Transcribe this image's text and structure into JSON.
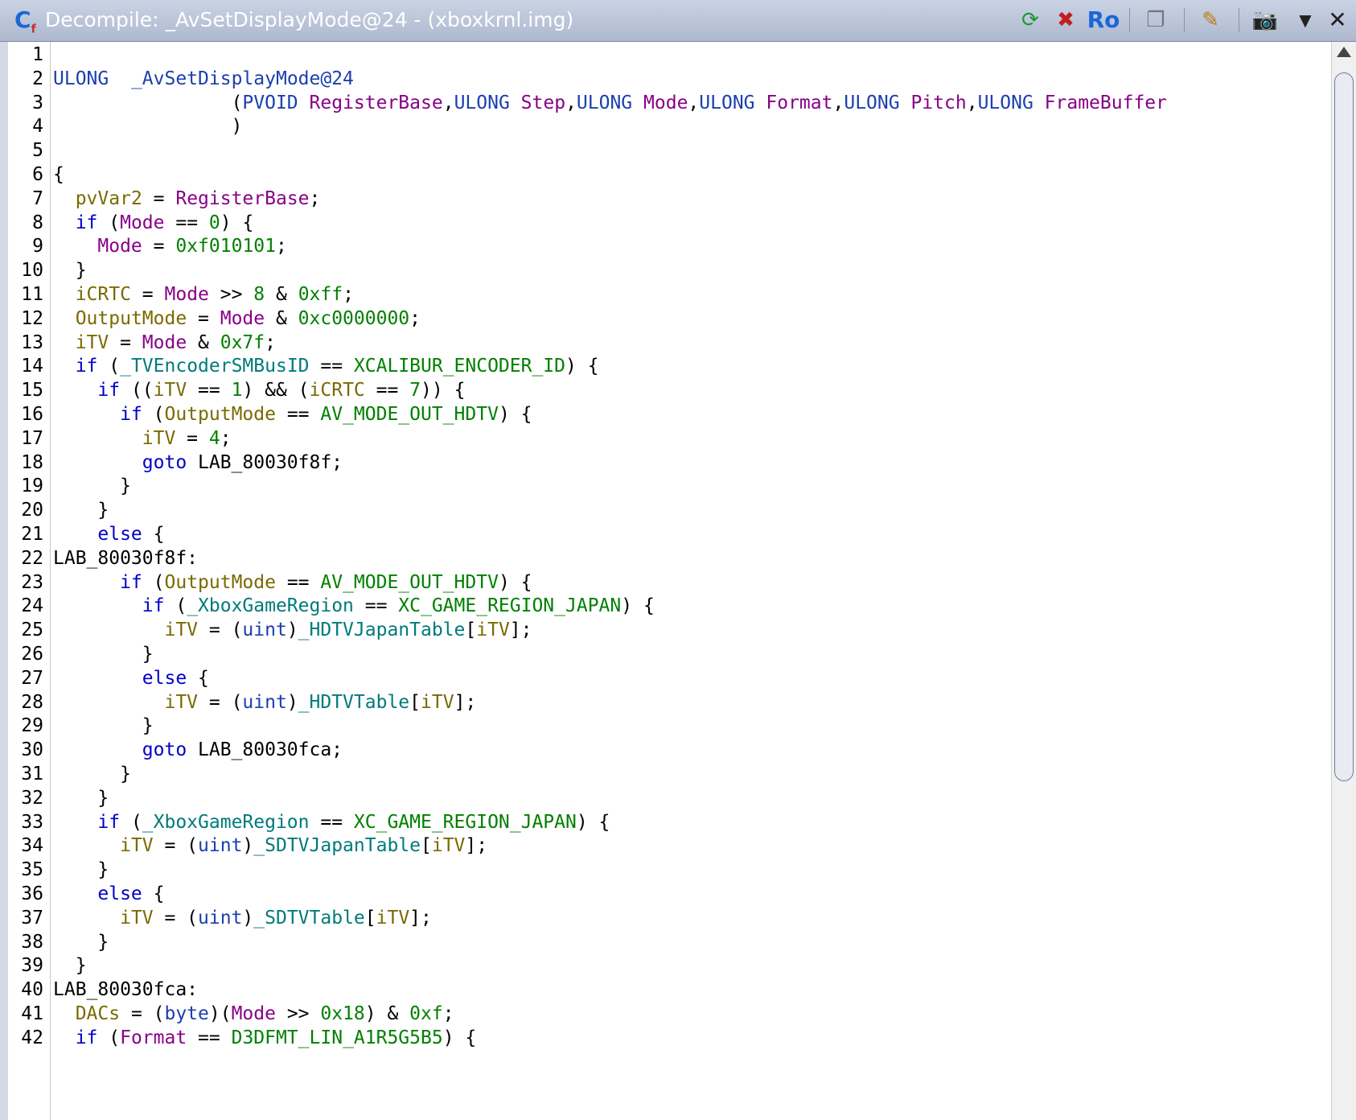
{
  "window": {
    "title": "Decompile: _AvSetDisplayMode@24 -  (xboxkrnl.img)",
    "icon_glyph": "C",
    "toolbar": [
      {
        "name": "refresh-icon",
        "glyph": "⟳"
      },
      {
        "name": "disable-snapshot-icon",
        "glyph": "✖"
      },
      {
        "name": "read-only-icon",
        "glyph": "Ro"
      },
      {
        "name": "copy-icon",
        "glyph": "❐"
      },
      {
        "name": "edit-icon",
        "glyph": "✎"
      },
      {
        "name": "snapshot-icon",
        "glyph": "📷"
      },
      {
        "name": "menu-dropdown-icon",
        "glyph": "▼"
      },
      {
        "name": "close-icon",
        "glyph": "✕"
      }
    ]
  },
  "code": {
    "lines": [
      {
        "n": "1",
        "t": []
      },
      {
        "n": "2",
        "t": [
          [
            "ty",
            "ULONG"
          ],
          [
            "",
            "  "
          ],
          [
            "fn",
            "_AvSetDisplayMode@24"
          ]
        ]
      },
      {
        "n": "3",
        "t": [
          [
            "",
            "                "
          ],
          [
            "",
            "("
          ],
          [
            "ty",
            "PVOID"
          ],
          [
            "",
            " "
          ],
          [
            "pr",
            "RegisterBase"
          ],
          [
            "",
            ","
          ],
          [
            "ty",
            "ULONG"
          ],
          [
            "",
            " "
          ],
          [
            "pr",
            "Step"
          ],
          [
            "",
            ","
          ],
          [
            "ty",
            "ULONG"
          ],
          [
            "",
            " "
          ],
          [
            "pr",
            "Mode"
          ],
          [
            "",
            ","
          ],
          [
            "ty",
            "ULONG"
          ],
          [
            "",
            " "
          ],
          [
            "pr",
            "Format"
          ],
          [
            "",
            ","
          ],
          [
            "ty",
            "ULONG"
          ],
          [
            "",
            " "
          ],
          [
            "pr",
            "Pitch"
          ],
          [
            "",
            ","
          ],
          [
            "ty",
            "ULONG"
          ],
          [
            "",
            " "
          ],
          [
            "pr",
            "FrameBuffer"
          ]
        ]
      },
      {
        "n": "4",
        "t": [
          [
            "",
            "                )"
          ]
        ]
      },
      {
        "n": "5",
        "t": []
      },
      {
        "n": "6",
        "t": [
          [
            "",
            "{"
          ]
        ]
      },
      {
        "n": "7",
        "t": [
          [
            "",
            "  "
          ],
          [
            "lv",
            "pvVar2"
          ],
          [
            "",
            " = "
          ],
          [
            "pr",
            "RegisterBase"
          ],
          [
            "",
            ";"
          ]
        ]
      },
      {
        "n": "8",
        "t": [
          [
            "",
            "  "
          ],
          [
            "kw",
            "if"
          ],
          [
            "",
            " ("
          ],
          [
            "pr",
            "Mode"
          ],
          [
            "",
            " == "
          ],
          [
            "nu",
            "0"
          ],
          [
            "",
            ") {"
          ]
        ]
      },
      {
        "n": "9",
        "t": [
          [
            "",
            "    "
          ],
          [
            "pr",
            "Mode"
          ],
          [
            "",
            " = "
          ],
          [
            "nu",
            "0xf010101"
          ],
          [
            "",
            ";"
          ]
        ]
      },
      {
        "n": "10",
        "t": [
          [
            "",
            "  }"
          ]
        ]
      },
      {
        "n": "11",
        "t": [
          [
            "",
            "  "
          ],
          [
            "lv",
            "iCRTC"
          ],
          [
            "",
            " = "
          ],
          [
            "pr",
            "Mode"
          ],
          [
            "",
            " >> "
          ],
          [
            "nu",
            "8"
          ],
          [
            "",
            " & "
          ],
          [
            "nu",
            "0xff"
          ],
          [
            "",
            ";"
          ]
        ]
      },
      {
        "n": "12",
        "t": [
          [
            "",
            "  "
          ],
          [
            "lv",
            "OutputMode"
          ],
          [
            "",
            " = "
          ],
          [
            "pr",
            "Mode"
          ],
          [
            "",
            " & "
          ],
          [
            "nu",
            "0xc0000000"
          ],
          [
            "",
            ";"
          ]
        ]
      },
      {
        "n": "13",
        "t": [
          [
            "",
            "  "
          ],
          [
            "lv",
            "iTV"
          ],
          [
            "",
            " = "
          ],
          [
            "pr",
            "Mode"
          ],
          [
            "",
            " & "
          ],
          [
            "nu",
            "0x7f"
          ],
          [
            "",
            ";"
          ]
        ]
      },
      {
        "n": "14",
        "t": [
          [
            "",
            "  "
          ],
          [
            "kw",
            "if"
          ],
          [
            "",
            " ("
          ],
          [
            "gl",
            "_TVEncoderSMBusID"
          ],
          [
            "",
            " == "
          ],
          [
            "cn",
            "XCALIBUR_ENCODER_ID"
          ],
          [
            "",
            ") {"
          ]
        ]
      },
      {
        "n": "15",
        "t": [
          [
            "",
            "    "
          ],
          [
            "kw",
            "if"
          ],
          [
            "",
            " (("
          ],
          [
            "lv",
            "iTV"
          ],
          [
            "",
            " == "
          ],
          [
            "nu",
            "1"
          ],
          [
            "",
            ") && ("
          ],
          [
            "lv",
            "iCRTC"
          ],
          [
            "",
            " == "
          ],
          [
            "nu",
            "7"
          ],
          [
            "",
            ")) {"
          ]
        ]
      },
      {
        "n": "16",
        "t": [
          [
            "",
            "      "
          ],
          [
            "kw",
            "if"
          ],
          [
            "",
            " ("
          ],
          [
            "lv",
            "OutputMode"
          ],
          [
            "",
            " == "
          ],
          [
            "cn",
            "AV_MODE_OUT_HDTV"
          ],
          [
            "",
            ") {"
          ]
        ]
      },
      {
        "n": "17",
        "t": [
          [
            "",
            "        "
          ],
          [
            "lv",
            "iTV"
          ],
          [
            "",
            " = "
          ],
          [
            "nu",
            "4"
          ],
          [
            "",
            ";"
          ]
        ]
      },
      {
        "n": "18",
        "t": [
          [
            "",
            "        "
          ],
          [
            "kw",
            "goto"
          ],
          [
            "",
            " LAB_80030f8f;"
          ]
        ]
      },
      {
        "n": "19",
        "t": [
          [
            "",
            "      }"
          ]
        ]
      },
      {
        "n": "20",
        "t": [
          [
            "",
            "    }"
          ]
        ]
      },
      {
        "n": "21",
        "t": [
          [
            "",
            "    "
          ],
          [
            "kw",
            "else"
          ],
          [
            "",
            " {"
          ]
        ]
      },
      {
        "n": "22",
        "t": [
          [
            "",
            "LAB_80030f8f:"
          ]
        ]
      },
      {
        "n": "23",
        "t": [
          [
            "",
            "      "
          ],
          [
            "kw",
            "if"
          ],
          [
            "",
            " ("
          ],
          [
            "lv",
            "OutputMode"
          ],
          [
            "",
            " == "
          ],
          [
            "cn",
            "AV_MODE_OUT_HDTV"
          ],
          [
            "",
            ") {"
          ]
        ]
      },
      {
        "n": "24",
        "t": [
          [
            "",
            "        "
          ],
          [
            "kw",
            "if"
          ],
          [
            "",
            " ("
          ],
          [
            "gl",
            "_XboxGameRegion"
          ],
          [
            "",
            " == "
          ],
          [
            "cn",
            "XC_GAME_REGION_JAPAN"
          ],
          [
            "",
            ") {"
          ]
        ]
      },
      {
        "n": "25",
        "t": [
          [
            "",
            "          "
          ],
          [
            "lv",
            "iTV"
          ],
          [
            "",
            " = ("
          ],
          [
            "ty",
            "uint"
          ],
          [
            "",
            ")"
          ],
          [
            "gl",
            "_HDTVJapanTable"
          ],
          [
            "",
            "["
          ],
          [
            "lv",
            "iTV"
          ],
          [
            "",
            "];"
          ]
        ]
      },
      {
        "n": "26",
        "t": [
          [
            "",
            "        }"
          ]
        ]
      },
      {
        "n": "27",
        "t": [
          [
            "",
            "        "
          ],
          [
            "kw",
            "else"
          ],
          [
            "",
            " {"
          ]
        ]
      },
      {
        "n": "28",
        "t": [
          [
            "",
            "          "
          ],
          [
            "lv",
            "iTV"
          ],
          [
            "",
            " = ("
          ],
          [
            "ty",
            "uint"
          ],
          [
            "",
            ")"
          ],
          [
            "gl",
            "_HDTVTable"
          ],
          [
            "",
            "["
          ],
          [
            "lv",
            "iTV"
          ],
          [
            "",
            "];"
          ]
        ]
      },
      {
        "n": "29",
        "t": [
          [
            "",
            "        }"
          ]
        ]
      },
      {
        "n": "30",
        "t": [
          [
            "",
            "        "
          ],
          [
            "kw",
            "goto"
          ],
          [
            "",
            " LAB_80030fca;"
          ]
        ]
      },
      {
        "n": "31",
        "t": [
          [
            "",
            "      }"
          ]
        ]
      },
      {
        "n": "32",
        "t": [
          [
            "",
            "    }"
          ]
        ]
      },
      {
        "n": "33",
        "t": [
          [
            "",
            "    "
          ],
          [
            "kw",
            "if"
          ],
          [
            "",
            " ("
          ],
          [
            "gl",
            "_XboxGameRegion"
          ],
          [
            "",
            " == "
          ],
          [
            "cn",
            "XC_GAME_REGION_JAPAN"
          ],
          [
            "",
            ") {"
          ]
        ]
      },
      {
        "n": "34",
        "t": [
          [
            "",
            "      "
          ],
          [
            "lv",
            "iTV"
          ],
          [
            "",
            " = ("
          ],
          [
            "ty",
            "uint"
          ],
          [
            "",
            ")"
          ],
          [
            "gl",
            "_SDTVJapanTable"
          ],
          [
            "",
            "["
          ],
          [
            "lv",
            "iTV"
          ],
          [
            "",
            "];"
          ]
        ]
      },
      {
        "n": "35",
        "t": [
          [
            "",
            "    }"
          ]
        ]
      },
      {
        "n": "36",
        "t": [
          [
            "",
            "    "
          ],
          [
            "kw",
            "else"
          ],
          [
            "",
            " {"
          ]
        ]
      },
      {
        "n": "37",
        "t": [
          [
            "",
            "      "
          ],
          [
            "lv",
            "iTV"
          ],
          [
            "",
            " = ("
          ],
          [
            "ty",
            "uint"
          ],
          [
            "",
            ")"
          ],
          [
            "gl",
            "_SDTVTable"
          ],
          [
            "",
            "["
          ],
          [
            "lv",
            "iTV"
          ],
          [
            "",
            "];"
          ]
        ]
      },
      {
        "n": "38",
        "t": [
          [
            "",
            "    }"
          ]
        ]
      },
      {
        "n": "39",
        "t": [
          [
            "",
            "  }"
          ]
        ]
      },
      {
        "n": "40",
        "t": [
          [
            "",
            "LAB_80030fca:"
          ]
        ]
      },
      {
        "n": "41",
        "t": [
          [
            "",
            "  "
          ],
          [
            "lv",
            "DACs"
          ],
          [
            "",
            " = ("
          ],
          [
            "ty",
            "byte"
          ],
          [
            "",
            ")("
          ],
          [
            "pr",
            "Mode"
          ],
          [
            "",
            " >> "
          ],
          [
            "nu",
            "0x18"
          ],
          [
            "",
            ") & "
          ],
          [
            "nu",
            "0xf"
          ],
          [
            "",
            ";"
          ]
        ]
      },
      {
        "n": "42",
        "t": [
          [
            "",
            "  "
          ],
          [
            "kw",
            "if"
          ],
          [
            "",
            " ("
          ],
          [
            "pr",
            "Format"
          ],
          [
            "",
            " == "
          ],
          [
            "cn",
            "D3DFMT_LIN_A1R5G5B5"
          ],
          [
            "",
            ") {"
          ]
        ]
      }
    ]
  },
  "scrollbar": {
    "position_fraction": 0.0,
    "visible_fraction": 0.68
  }
}
